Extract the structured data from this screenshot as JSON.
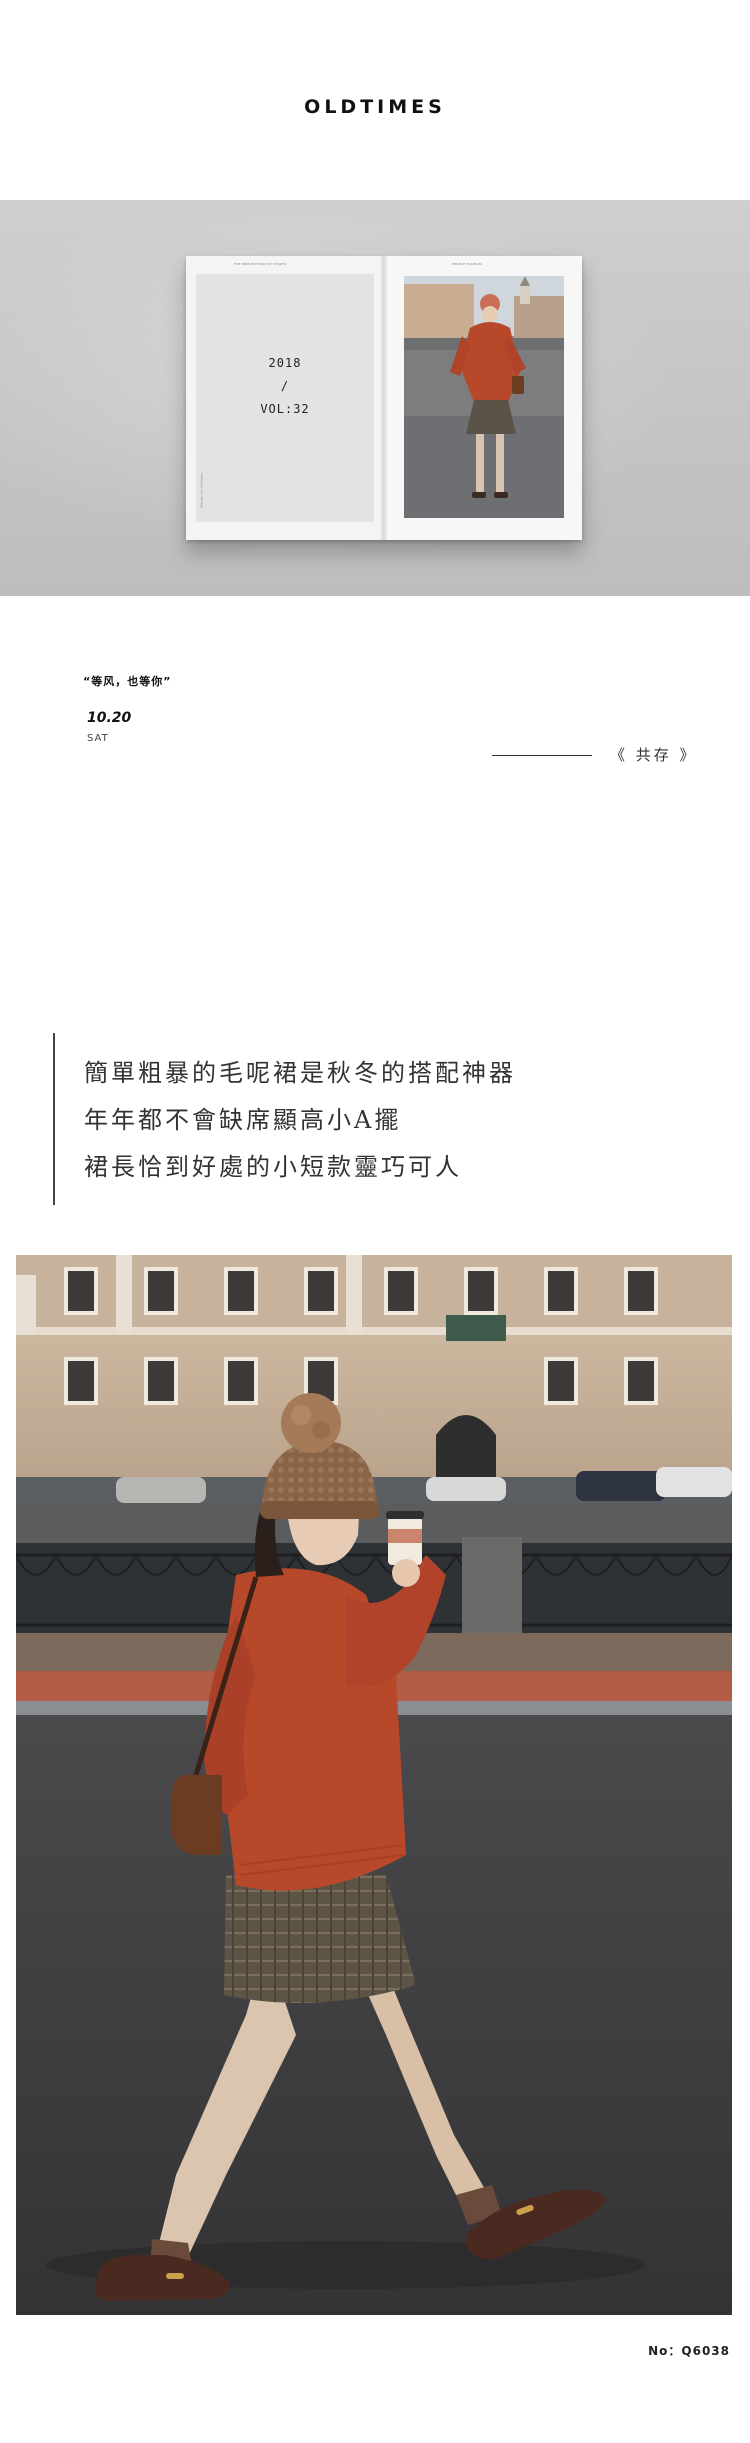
{
  "brand": "OLDTIMES",
  "magazine": {
    "left_header": "THE NEW EDITION OF STORYS",
    "right_header": "PEOPLE FASHION",
    "year": "2018",
    "slash": "/",
    "vol": "VOL:32",
    "side_text": "Design by Oldtimes"
  },
  "post": {
    "quote": "“等风，也等你”",
    "date": "10.20",
    "weekday": "SAT",
    "coexist": "《 共存 》"
  },
  "description": {
    "lines": [
      "簡單粗暴的毛呢裙是秋冬的搭配神器",
      "年年都不會缺席顯高小A擺",
      "裙長恰到好處的小短款靈巧可人"
    ]
  },
  "footer": {
    "code": "No：Q6038"
  },
  "colors": {
    "sweater": "#b8482a",
    "hat": "#8a6447",
    "skirt": "#5e5446",
    "building": "#c9b29a"
  }
}
